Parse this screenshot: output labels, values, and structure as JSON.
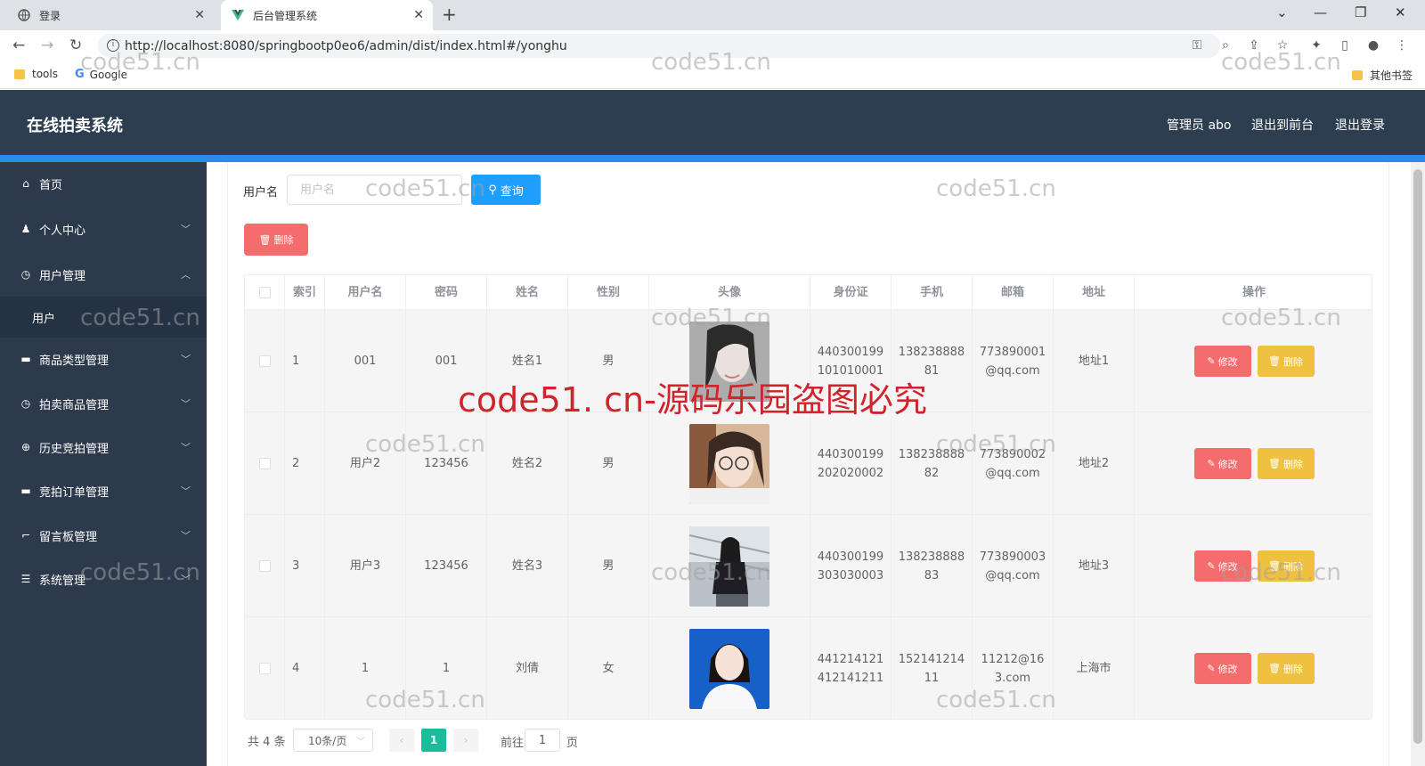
{
  "browser": {
    "tabs": [
      {
        "title": "登录"
      },
      {
        "title": "后台管理系统"
      }
    ],
    "url": "http://localhost:8080/springbootp0eo6/admin/dist/index.html#/yonghu",
    "bookmarks": [
      {
        "label": "tools"
      },
      {
        "label": "Google"
      }
    ],
    "other_bookmarks": "其他书签"
  },
  "header": {
    "brand": "在线拍卖系统",
    "admin": "管理员 abo",
    "back_front": "退出到前台",
    "logout": "退出登录"
  },
  "sidebar": {
    "items": [
      {
        "label": "首页",
        "icon": "home-icon"
      },
      {
        "label": "个人中心",
        "icon": "user-icon"
      },
      {
        "label": "用户管理",
        "icon": "clock-icon"
      },
      {
        "label": "用户"
      },
      {
        "label": "商品类型管理",
        "icon": "goods-icon"
      },
      {
        "label": "拍卖商品管理",
        "icon": "clock-icon"
      },
      {
        "label": "历史竞拍管理",
        "icon": "target-icon"
      },
      {
        "label": "竞拍订单管理",
        "icon": "order-icon"
      },
      {
        "label": "留言板管理",
        "icon": "message-icon"
      },
      {
        "label": "系统管理",
        "icon": "settings-icon"
      }
    ]
  },
  "search": {
    "label": "用户名",
    "placeholder": "用户名",
    "button": "查询"
  },
  "toolbar": {
    "delete_label": "删除"
  },
  "table": {
    "columns": [
      "索引",
      "用户名",
      "密码",
      "姓名",
      "性别",
      "头像",
      "身份证",
      "手机",
      "邮箱",
      "地址",
      "操作"
    ],
    "rows": [
      {
        "index": "1",
        "username": "001",
        "password": "001",
        "name": "姓名1",
        "gender": "男",
        "idcard": "440300199101010001",
        "phone": "13823888881",
        "email": "773890001@qq.com",
        "address": "地址1"
      },
      {
        "index": "2",
        "username": "用户2",
        "password": "123456",
        "name": "姓名2",
        "gender": "男",
        "idcard": "440300199202020002",
        "phone": "13823888882",
        "email": "773890002@qq.com",
        "address": "地址2"
      },
      {
        "index": "3",
        "username": "用户3",
        "password": "123456",
        "name": "姓名3",
        "gender": "男",
        "idcard": "440300199303030003",
        "phone": "13823888883",
        "email": "773890003@qq.com",
        "address": "地址3"
      },
      {
        "index": "4",
        "username": "1",
        "password": "1",
        "name": "刘倩",
        "gender": "女",
        "idcard": "441214121412141211",
        "phone": "15214121411",
        "email": "11212@163.com",
        "address": "上海市"
      }
    ],
    "edit_label": "修改",
    "delete_label": "删除"
  },
  "pagination": {
    "total": "共 4 条",
    "page_size": "10条/页",
    "current_page": "1",
    "goto_prefix": "前往",
    "goto_value": "1",
    "goto_suffix": "页"
  },
  "watermark": {
    "text": "code51.cn",
    "banner": "code51. cn-源码乐园盗图必究"
  },
  "colors": {
    "header_bg": "#2c3e50",
    "sidebar_bg": "#2d3a4b",
    "accent_blue": "#1e9fff",
    "danger": "#f56c6c",
    "warning": "#f0c040",
    "pager_active": "#1abc9c"
  }
}
